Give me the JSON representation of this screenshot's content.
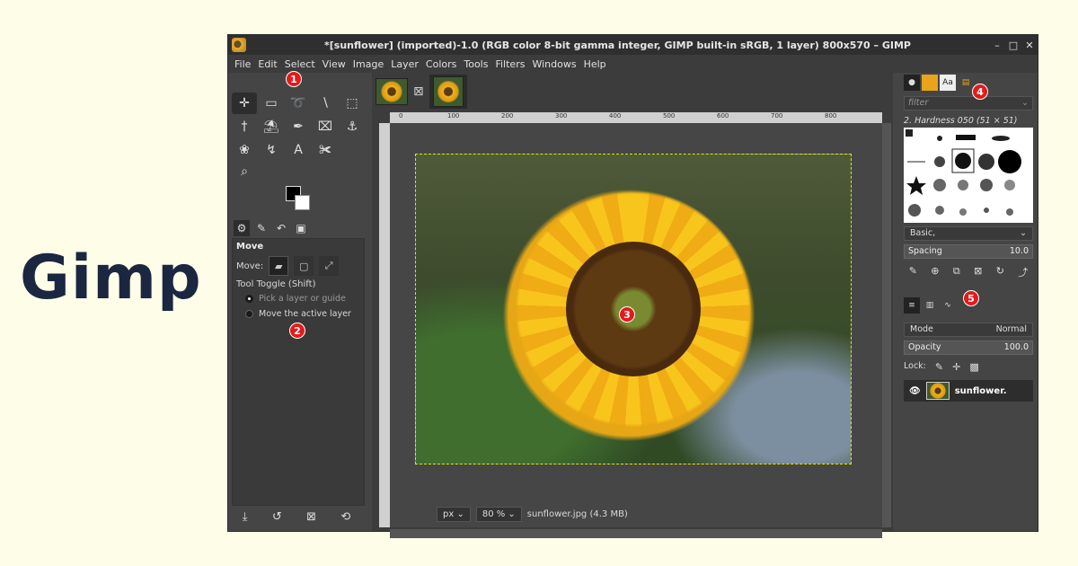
{
  "brand": "Gimp",
  "window": {
    "title": "*[sunflower] (imported)-1.0 (RGB color 8-bit gamma integer, GIMP built-in sRGB, 1 layer) 800x570 – GIMP",
    "controls": {
      "minimize": "–",
      "maximize": "□",
      "close": "✕"
    }
  },
  "menu": [
    "File",
    "Edit",
    "Select",
    "View",
    "Image",
    "Layer",
    "Colors",
    "Tools",
    "Filters",
    "Windows",
    "Help"
  ],
  "badges": [
    "1",
    "2",
    "3",
    "4",
    "5"
  ],
  "tools": {
    "icons": [
      "move-tool-icon",
      "rect-select-icon",
      "lasso-icon",
      "fuzzy-select-icon",
      "crop-icon",
      "warp-icon",
      "bucket-fill-icon",
      "brush-icon",
      "eraser-icon",
      "clone-icon",
      "smudge-icon",
      "path-icon",
      "text-icon",
      "color-picker-icon",
      "zoom-icon"
    ],
    "glyphs": [
      "✛",
      "▭",
      "➰",
      "∖",
      "⬚",
      "†",
      "⛱",
      "✒",
      "⌧",
      "⚓",
      "❀",
      "↯",
      "A",
      "✀",
      "⌕"
    ]
  },
  "tool_options": {
    "heading": "Move",
    "move_label": "Move:",
    "toggle_label": "Tool Toggle  (Shift)",
    "radio1": "Pick a layer or guide",
    "radio2": "Move the active layer"
  },
  "canvas": {
    "ruler_labels": [
      "0",
      "100",
      "200",
      "300",
      "400",
      "500",
      "600",
      "700",
      "800"
    ],
    "unit": "px",
    "zoom": "80 %",
    "status": "sunflower.jpg (4.3 MB)"
  },
  "brushes": {
    "filter_placeholder": "filter",
    "brush_name": "2. Hardness 050 (51 × 51)",
    "preset": "Basic,",
    "spacing_label": "Spacing",
    "spacing_value": "10.0"
  },
  "layers": {
    "mode_label": "Mode",
    "mode_value": "Normal",
    "opacity_label": "Opacity",
    "opacity_value": "100.0",
    "lock_label": "Lock:",
    "layer_name": "sunflower."
  }
}
